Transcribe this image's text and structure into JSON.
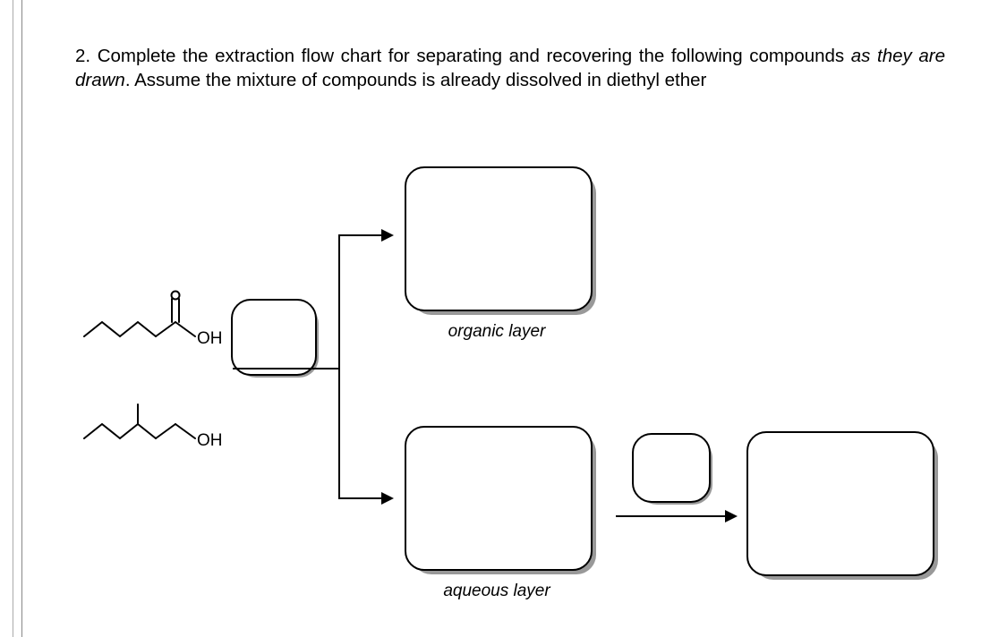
{
  "question": {
    "number": "2.",
    "text_part1": "Complete the extraction flow chart for separating and recovering the following compounds ",
    "em1": "as they are drawn",
    "text_part2": ". Assume the mixture of compounds is already dissolved in diethyl ether"
  },
  "molecules": {
    "acid_oh": "OH",
    "alcohol_oh": "OH"
  },
  "labels": {
    "organic": "organic layer",
    "aqueous": "aqueous layer"
  }
}
